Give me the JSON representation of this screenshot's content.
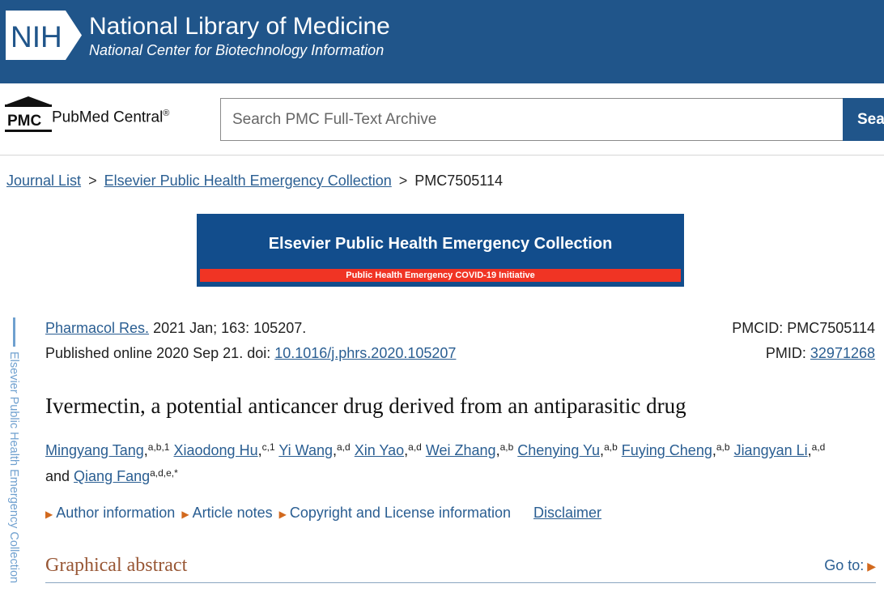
{
  "nih": {
    "logo_text": "NIH",
    "title": "National Library of Medicine",
    "subtitle": "National Center for Biotechnology Information"
  },
  "pmc": {
    "logo_text": "PMC",
    "name": "PubMed Central",
    "registered": "®",
    "search_placeholder": "Search PMC Full-Text Archive",
    "search_button": "Search"
  },
  "breadcrumb": {
    "items": [
      "Journal List",
      "Elsevier Public Health Emergency Collection"
    ],
    "separator": ">",
    "current": "PMC7505114"
  },
  "banner": {
    "title": "Elsevier Public Health Emergency Collection",
    "strip": "Public Health Emergency COVID-19 Initiative"
  },
  "side_tab": "Elsevier Public Health Emergency Collection",
  "citation": {
    "journal": "Pharmacol Res.",
    "details": " 2021 Jan; 163: 105207.",
    "published": "Published online 2020 Sep 21. doi: ",
    "doi": "10.1016/j.phrs.2020.105207",
    "pmcid_label": "PMCID: PMC7505114",
    "pmid_label": "PMID: ",
    "pmid": "32971268"
  },
  "article": {
    "title": "Ivermectin, a potential anticancer drug derived from an antiparasitic drug"
  },
  "authors": [
    {
      "name": "Mingyang Tang",
      "sup": "a,b,1",
      "after": ", "
    },
    {
      "name": "Xiaodong Hu",
      "sup": "c,1",
      "after": " "
    },
    {
      "name": "Yi Wang",
      "sup": "a,d",
      "after": " "
    },
    {
      "name": "Xin Yao",
      "sup": "a,d",
      "after": " "
    },
    {
      "name": "Wei Zhang",
      "sup": "a,b",
      "after": " "
    },
    {
      "name": "Chenying Yu",
      "sup": "a,b",
      "after": " "
    },
    {
      "name": "Fuying Cheng",
      "sup": "a,b",
      "after": " "
    },
    {
      "name": "Jiangyan Li",
      "sup": "a,d",
      "after": " and "
    },
    {
      "name": "Qiang Fang",
      "sup": "a,d,e,*",
      "after": ""
    }
  ],
  "info_links": {
    "author_info": "Author information",
    "article_notes": "Article notes",
    "copyright": "Copyright and License information",
    "disclaimer": "Disclaimer"
  },
  "section": {
    "title": "Graphical abstract",
    "goto": "Go to:"
  },
  "colors": {
    "nih_blue": "#20558a",
    "link": "#2a5e92",
    "section_title": "#985735",
    "banner_red": "#f03424"
  }
}
